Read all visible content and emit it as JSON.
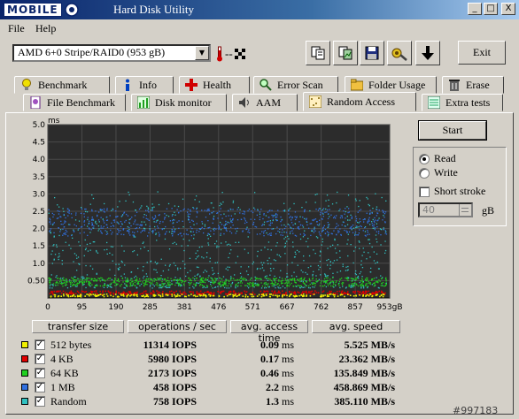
{
  "window": {
    "logo_text": "MOBILE",
    "title": "Hard Disk Utility",
    "min_label": "_",
    "max_label": "□",
    "close_label": "X"
  },
  "menu": [
    {
      "label": "File"
    },
    {
      "label": "Help"
    }
  ],
  "toolbar": {
    "drive": "AMD    6+0 Stripe/RAID0 (953 gB)",
    "temperature": "--",
    "exit_label": "Exit"
  },
  "tabs_row1": [
    {
      "label": "Benchmark",
      "icon": "lightbulb-icon",
      "color": "#e8d000"
    },
    {
      "label": "Info",
      "icon": "info-icon",
      "color": "#0040c0"
    },
    {
      "label": "Health",
      "icon": "health-cross-icon",
      "color": "#d00000"
    },
    {
      "label": "Error Scan",
      "icon": "magnifier-icon",
      "color": "#208020"
    },
    {
      "label": "Folder Usage",
      "icon": "folder-icon",
      "color": "#e0b030"
    },
    {
      "label": "Erase",
      "icon": "trash-icon",
      "color": "#404040"
    }
  ],
  "tabs_row2": [
    {
      "label": "File Benchmark",
      "icon": "file-benchmark-icon",
      "color": "#8040a0"
    },
    {
      "label": "Disk monitor",
      "icon": "disk-monitor-icon",
      "color": "#20a020"
    },
    {
      "label": "AAM",
      "icon": "speaker-icon",
      "color": "#404040"
    },
    {
      "label": "Random Access",
      "icon": "random-access-icon",
      "color": "#c0a040"
    },
    {
      "label": "Extra tests",
      "icon": "extra-tests-icon",
      "color": "#20a060"
    }
  ],
  "controls": {
    "start_label": "Start",
    "read_label": "Read",
    "write_label": "Write",
    "mode": "Read",
    "short_stroke_label": "Short stroke",
    "short_stroke_checked": false,
    "stroke_value": "40",
    "stroke_unit": "gB"
  },
  "chart_data": {
    "type": "scatter",
    "ylabel": "ms",
    "xlabel": "",
    "y_ticks": [
      "5.0",
      "4.5",
      "4.0",
      "3.5",
      "3.0",
      "2.5",
      "2.0",
      "1.5",
      "1.0",
      "0.50"
    ],
    "y_values": [
      5.0,
      4.5,
      4.0,
      3.5,
      3.0,
      2.5,
      2.0,
      1.5,
      1.0,
      0.5
    ],
    "x_ticks": [
      "0",
      "95",
      "190",
      "285",
      "381",
      "476",
      "571",
      "667",
      "762",
      "857",
      "953gB"
    ],
    "x_values": [
      0,
      95,
      190,
      285,
      381,
      476,
      571,
      667,
      762,
      857,
      953
    ],
    "ylim": [
      0,
      5
    ],
    "xlim": [
      0,
      953
    ],
    "grid": true,
    "background": "#2c2c2c",
    "series": [
      {
        "name": "512 bytes",
        "color": "#f0f000",
        "band_ms": [
          0.05,
          0.13
        ],
        "mean_ms": 0.09
      },
      {
        "name": "4 KB",
        "color": "#e00000",
        "band_ms": [
          0.12,
          0.22
        ],
        "mean_ms": 0.17
      },
      {
        "name": "64 KB",
        "color": "#20d020",
        "band_ms": [
          0.35,
          0.6
        ],
        "mean_ms": 0.46
      },
      {
        "name": "1 MB",
        "color": "#3070e0",
        "band_ms": [
          1.8,
          2.6
        ],
        "mean_ms": 2.2
      },
      {
        "name": "Random",
        "color": "#30c0c0",
        "band_ms": [
          0.3,
          2.8
        ],
        "mean_ms": 1.3
      }
    ]
  },
  "results": {
    "headers": [
      "transfer size",
      "operations / sec",
      "avg. access time",
      "avg. speed"
    ],
    "rows": [
      {
        "name": "512 bytes",
        "color": "#f0f000",
        "checked": true,
        "ops": "11314",
        "ops_unit": "IOPS",
        "access": "0.09",
        "access_unit": "ms",
        "speed": "5.525",
        "speed_unit": "MB/s"
      },
      {
        "name": "4 KB",
        "color": "#e00000",
        "checked": true,
        "ops": "5980",
        "ops_unit": "IOPS",
        "access": "0.17",
        "access_unit": "ms",
        "speed": "23.362",
        "speed_unit": "MB/s"
      },
      {
        "name": "64 KB",
        "color": "#20d020",
        "checked": true,
        "ops": "2173",
        "ops_unit": "IOPS",
        "access": "0.46",
        "access_unit": "ms",
        "speed": "135.849",
        "speed_unit": "MB/s"
      },
      {
        "name": "1 MB",
        "color": "#3070e0",
        "checked": true,
        "ops": "458",
        "ops_unit": "IOPS",
        "access": "2.2",
        "access_unit": "ms",
        "speed": "458.869",
        "speed_unit": "MB/s"
      },
      {
        "name": "Random",
        "color": "#30c0c0",
        "checked": true,
        "ops": "758",
        "ops_unit": "IOPS",
        "access": "1.3",
        "access_unit": "ms",
        "speed": "385.110",
        "speed_unit": "MB/s"
      }
    ]
  },
  "status_text": "#997183"
}
